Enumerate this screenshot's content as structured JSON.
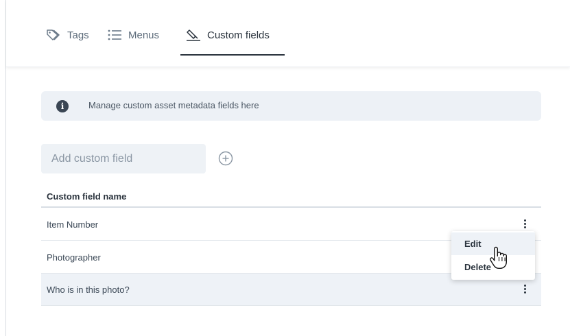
{
  "tabs": [
    {
      "label": "Tags",
      "icon": "tag-icon",
      "active": false
    },
    {
      "label": "Menus",
      "icon": "list-icon",
      "active": false
    },
    {
      "label": "Custom fields",
      "icon": "custom-fields-icon",
      "active": true
    }
  ],
  "info": {
    "icon": "info-icon",
    "text": "Manage custom asset metadata fields here"
  },
  "add_field": {
    "placeholder": "Add custom field",
    "value": "",
    "button_icon": "plus-circle-icon"
  },
  "table": {
    "header": "Custom field name",
    "rows": [
      {
        "name": "Item Number"
      },
      {
        "name": "Photographer"
      },
      {
        "name": "Who is in this photo?"
      }
    ]
  },
  "context_menu": {
    "items": [
      "Edit",
      "Delete"
    ],
    "hovered": "Edit"
  },
  "colors": {
    "text_dark": "#2a333d",
    "text_muted": "#5b6a79",
    "banner_bg": "#edf1f6",
    "row_highlight": "#eef2f7"
  }
}
